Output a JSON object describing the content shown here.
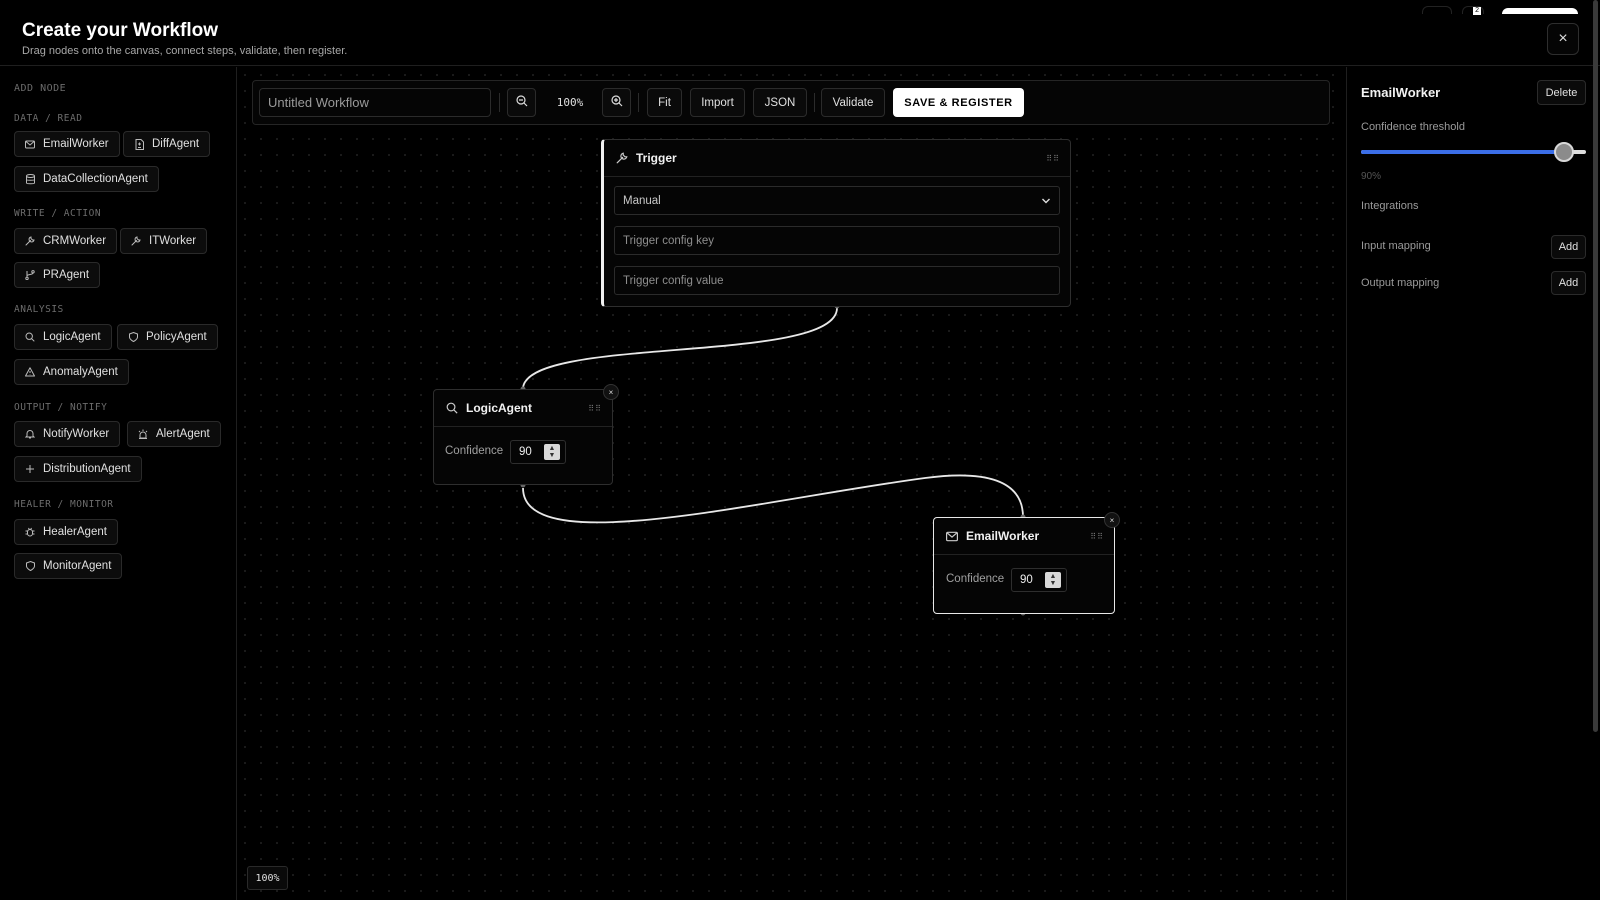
{
  "header": {
    "title": "Create your Workflow",
    "subtitle": "Drag nodes onto the canvas, connect steps, validate, then register.",
    "close_icon": "×",
    "badge": "2"
  },
  "sidebar": {
    "add_node_label": "ADD NODE",
    "sections": [
      {
        "label": "DATA / READ",
        "items": [
          {
            "label": "EmailWorker",
            "icon": "mail-icon"
          },
          {
            "label": "DiffAgent",
            "icon": "file-diff-icon"
          },
          {
            "label": "DataCollectionAgent",
            "icon": "database-icon"
          }
        ]
      },
      {
        "label": "WRITE / ACTION",
        "items": [
          {
            "label": "CRMWorker",
            "icon": "wrench-icon"
          },
          {
            "label": "ITWorker",
            "icon": "wrench-icon"
          },
          {
            "label": "PRAgent",
            "icon": "git-branch-icon"
          }
        ]
      },
      {
        "label": "ANALYSIS",
        "items": [
          {
            "label": "LogicAgent",
            "icon": "search-icon"
          },
          {
            "label": "PolicyAgent",
            "icon": "shield-icon"
          },
          {
            "label": "AnomalyAgent",
            "icon": "warning-icon"
          }
        ]
      },
      {
        "label": "OUTPUT / NOTIFY",
        "items": [
          {
            "label": "NotifyWorker",
            "icon": "bell-icon"
          },
          {
            "label": "AlertAgent",
            "icon": "siren-icon"
          },
          {
            "label": "DistributionAgent",
            "icon": "plus-icon"
          }
        ]
      },
      {
        "label": "HEALER / MONITOR",
        "items": [
          {
            "label": "HealerAgent",
            "icon": "bug-icon"
          },
          {
            "label": "MonitorAgent",
            "icon": "shield-icon"
          }
        ]
      }
    ]
  },
  "toolbar": {
    "workflow_name_placeholder": "Untitled Workflow",
    "zoom_out_icon": "zoom-out-icon",
    "zoom_in_icon": "zoom-in-icon",
    "zoom_level": "100%",
    "fit_label": "Fit",
    "import_label": "Import",
    "json_label": "JSON",
    "validate_label": "Validate",
    "save_label": "SAVE & REGISTER"
  },
  "nodes": {
    "trigger": {
      "title": "Trigger",
      "icon": "wrench-icon",
      "mode": "Manual",
      "key_placeholder": "Trigger config key",
      "value_placeholder": "Trigger config value"
    },
    "logic": {
      "title": "LogicAgent",
      "icon": "search-icon",
      "confidence_label": "Confidence",
      "confidence_value": "90",
      "remove": "×"
    },
    "email": {
      "title": "EmailWorker",
      "icon": "mail-icon",
      "confidence_label": "Confidence",
      "confidence_value": "90",
      "remove": "×"
    }
  },
  "canvas": {
    "zoom_badge": "100%",
    "grip": "⠿⠿"
  },
  "panel": {
    "title": "EmailWorker",
    "delete_label": "Delete",
    "threshold_label": "Confidence threshold",
    "threshold_value": "90%",
    "threshold_fraction": 0.9,
    "integrations_label": "Integrations",
    "input_mapping_label": "Input mapping",
    "output_mapping_label": "Output mapping",
    "add_label": "Add",
    "accent": "#3b6ee8"
  }
}
